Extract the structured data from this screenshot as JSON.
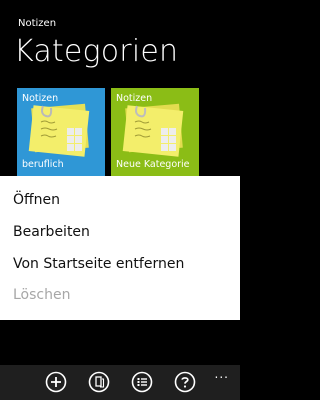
{
  "app": {
    "title": "Notizen"
  },
  "page": {
    "title": "Kategorien"
  },
  "tiles": [
    {
      "label": "Notizen",
      "name": "beruflich",
      "color": "#2f97d6"
    },
    {
      "label": "Notizen",
      "name": "Neue Kategorie",
      "color": "#8bbd16"
    }
  ],
  "menu": {
    "items": [
      {
        "label": "Öffnen",
        "enabled": true
      },
      {
        "label": "Bearbeiten",
        "enabled": true
      },
      {
        "label": "Von Startseite entfernen",
        "enabled": true
      },
      {
        "label": "Löschen",
        "enabled": false
      }
    ]
  },
  "appbar": {
    "icons": [
      "add-icon",
      "edit-note-icon",
      "list-icon",
      "help-icon"
    ],
    "more": "..."
  }
}
